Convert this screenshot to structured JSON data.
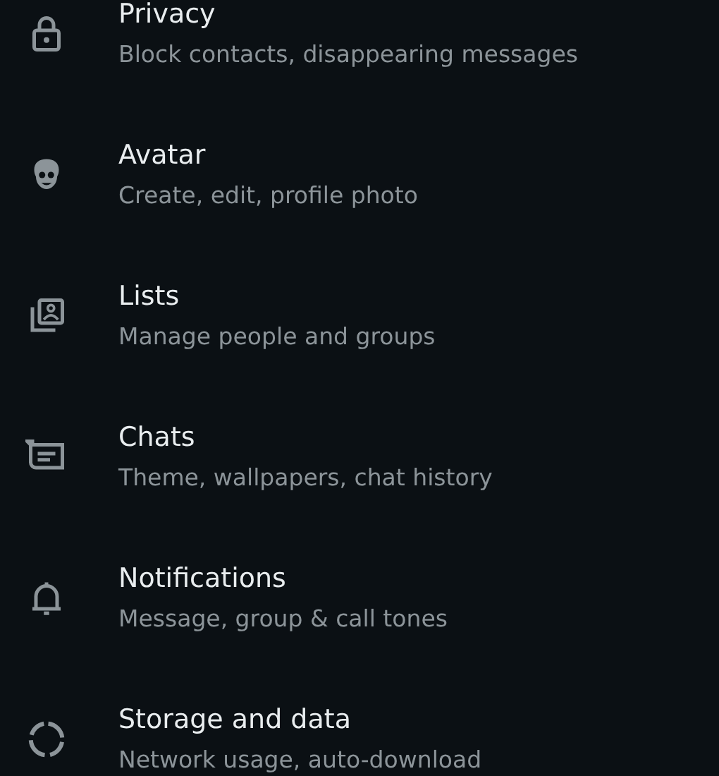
{
  "settings": [
    {
      "kind": "lock",
      "title": "Privacy",
      "subtitle": "Block contacts, disappearing messages"
    },
    {
      "kind": "avatar",
      "title": "Avatar",
      "subtitle": "Create, edit, profile photo"
    },
    {
      "kind": "lists",
      "title": "Lists",
      "subtitle": "Manage people and groups"
    },
    {
      "kind": "chat",
      "title": "Chats",
      "subtitle": "Theme, wallpapers, chat history"
    },
    {
      "kind": "bell",
      "title": "Notifications",
      "subtitle": "Message, group & call tones"
    },
    {
      "kind": "storage",
      "title": "Storage and data",
      "subtitle": "Network usage, auto-download"
    }
  ]
}
